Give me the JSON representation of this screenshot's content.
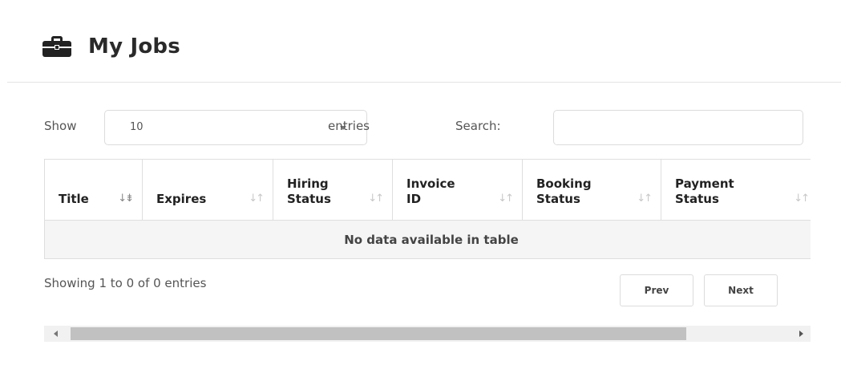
{
  "header": {
    "title": "My Jobs",
    "icon": "briefcase-icon"
  },
  "controls": {
    "show_label": "Show",
    "length_value": "10",
    "entries_label": "entries",
    "search_label": "Search:",
    "search_value": ""
  },
  "table": {
    "columns": [
      {
        "line1": "Title",
        "line2": "",
        "sort": "↓⇟"
      },
      {
        "line1": "Expires",
        "line2": "",
        "sort": "↓↑"
      },
      {
        "line1": "Hiring",
        "line2": "Status",
        "sort": "↓↑"
      },
      {
        "line1": "Invoice",
        "line2": "ID",
        "sort": "↓↑"
      },
      {
        "line1": "Booking",
        "line2": "Status",
        "sort": "↓↑"
      },
      {
        "line1": "Payment",
        "line2": "Status",
        "sort": "↓↑"
      }
    ],
    "empty_message": "No data available in table"
  },
  "footer": {
    "info": "Showing 1 to 0 of 0 entries",
    "prev_label": "Prev",
    "next_label": "Next"
  }
}
